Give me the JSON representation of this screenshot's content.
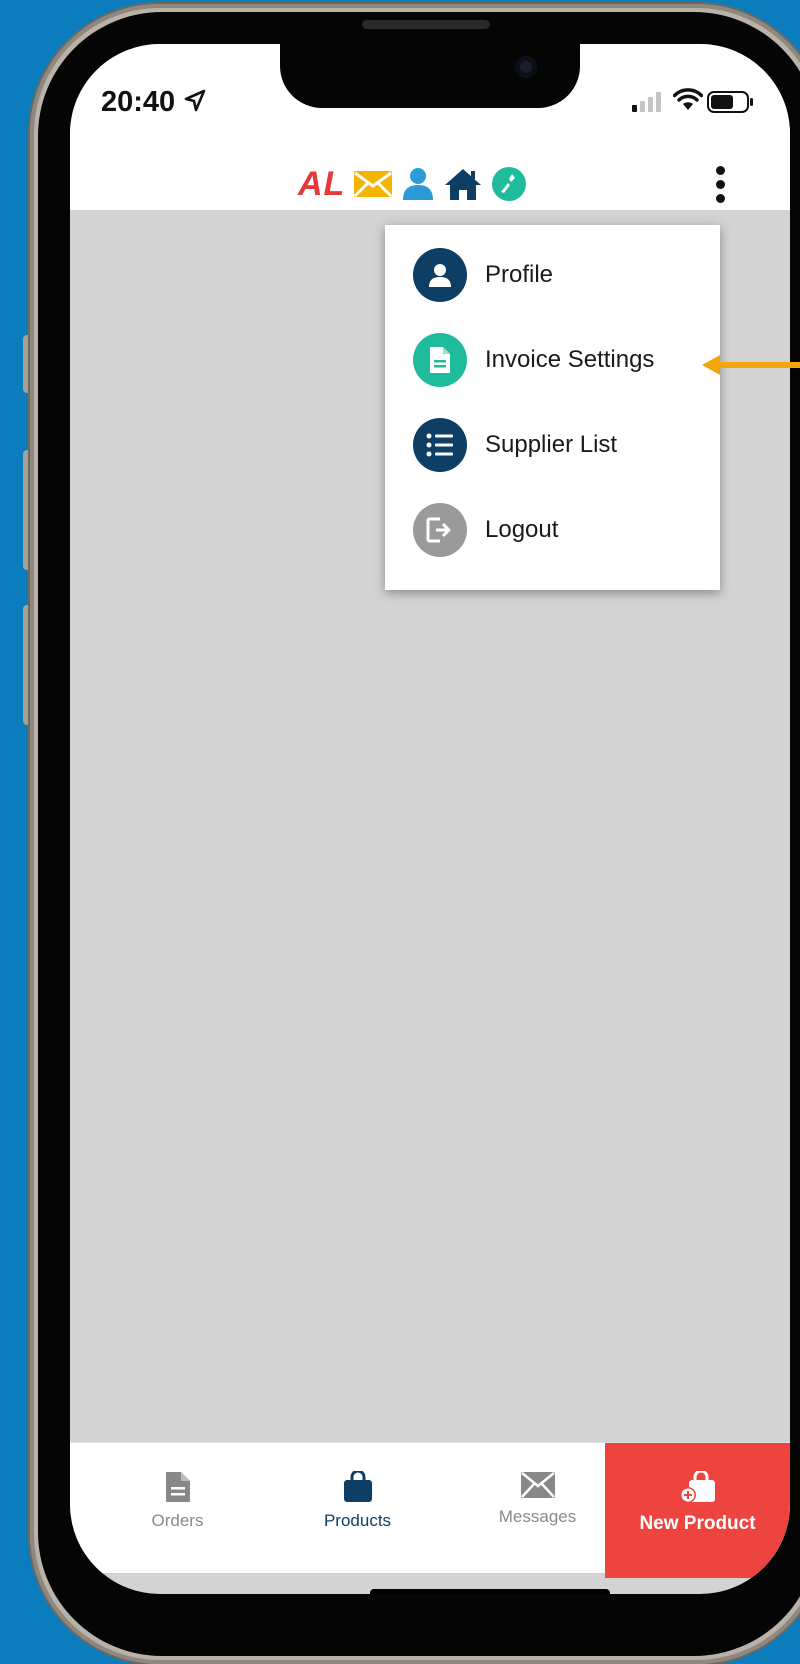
{
  "status_bar": {
    "time": "20:40"
  },
  "header": {
    "logo_text": "AL"
  },
  "menu": {
    "items": [
      {
        "label": "Profile",
        "icon": "person-icon",
        "color": "#0e3e64"
      },
      {
        "label": "Invoice Settings",
        "icon": "document-icon",
        "color": "#1fbc9c"
      },
      {
        "label": "Supplier List",
        "icon": "list-icon",
        "color": "#0e3e64"
      },
      {
        "label": "Logout",
        "icon": "logout-icon",
        "color": "#9a9a9a"
      }
    ]
  },
  "tabs": {
    "orders": "Orders",
    "products": "Products",
    "messages": "Messages",
    "new_product": "New Product"
  },
  "colors": {
    "accent": "#0e3e64",
    "teal": "#1fbc9c",
    "red": "#ee4440",
    "yellow": "#f4b400",
    "light_blue": "#2b9bd8",
    "annotation_arrow": "#f4a60b",
    "background": "#0b7dbd"
  }
}
